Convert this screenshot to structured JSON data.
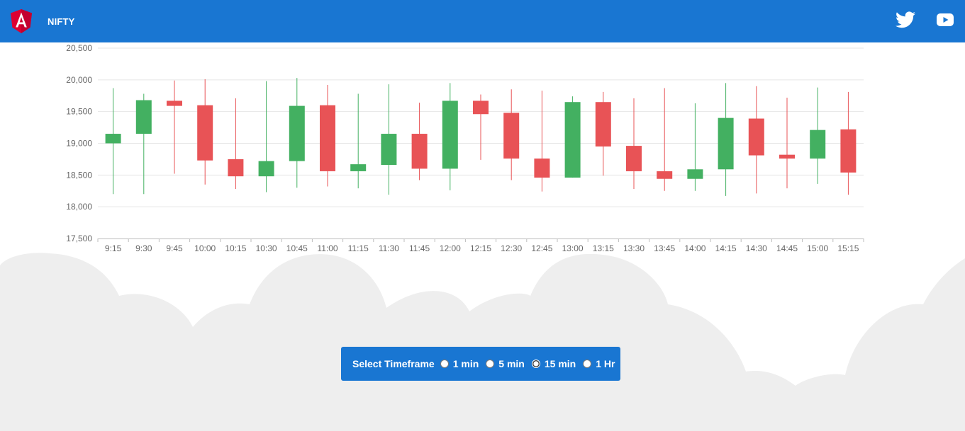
{
  "app": {
    "title": "NIFTY",
    "colors": {
      "toolbar": "#1976d2",
      "bull": "#43b061",
      "bear": "#e85356",
      "cloud": "#eeeeee"
    },
    "icons": [
      "angular-logo-icon",
      "twitter-icon",
      "youtube-icon"
    ]
  },
  "timeframe": {
    "label": "Select Timeframe",
    "options": [
      {
        "label": "1 min",
        "selected": false
      },
      {
        "label": "5 min",
        "selected": false
      },
      {
        "label": "15 min",
        "selected": true
      },
      {
        "label": "1 Hr",
        "selected": false
      }
    ]
  },
  "chart_data": {
    "type": "candlestick",
    "x": [
      "9:15",
      "9:30",
      "9:45",
      "10:00",
      "10:15",
      "10:30",
      "10:45",
      "11:00",
      "11:15",
      "11:30",
      "11:45",
      "12:00",
      "12:15",
      "12:30",
      "12:45",
      "13:00",
      "13:15",
      "13:30",
      "13:45",
      "14:00",
      "14:15",
      "14:30",
      "14:45",
      "15:00",
      "15:15"
    ],
    "open": [
      19000,
      19150,
      19670,
      19600,
      18750,
      18480,
      18720,
      19600,
      18560,
      18660,
      19150,
      18600,
      19670,
      19480,
      18760,
      18460,
      19650,
      18960,
      18560,
      18440,
      18590,
      19390,
      18820,
      18760,
      19220
    ],
    "close": [
      19150,
      19680,
      19590,
      18730,
      18480,
      18720,
      19590,
      18560,
      18670,
      19150,
      18600,
      19670,
      19460,
      18760,
      18460,
      19650,
      18950,
      18560,
      18440,
      18590,
      19400,
      18810,
      18760,
      19210,
      18540
    ],
    "high": [
      19870,
      19780,
      19990,
      20010,
      19710,
      19980,
      20030,
      19920,
      19780,
      19930,
      19640,
      19950,
      19770,
      19850,
      19830,
      19740,
      19810,
      19710,
      19870,
      19630,
      19950,
      19900,
      19720,
      19880,
      19810
    ],
    "low": [
      18200,
      18200,
      18520,
      18350,
      18280,
      18230,
      18300,
      18320,
      18290,
      18190,
      18420,
      18260,
      18740,
      18420,
      18240,
      18460,
      18490,
      18280,
      18250,
      18250,
      18170,
      18210,
      18290,
      18360,
      18190
    ],
    "ylim": [
      17500,
      20500
    ],
    "yticks": [
      17500,
      18000,
      18500,
      19000,
      19500,
      20000,
      20500
    ],
    "ytick_labels": [
      "17,500",
      "18,000",
      "18,500",
      "19,000",
      "19,500",
      "20,000",
      "20,500"
    ],
    "grid": true,
    "legend": "none"
  }
}
